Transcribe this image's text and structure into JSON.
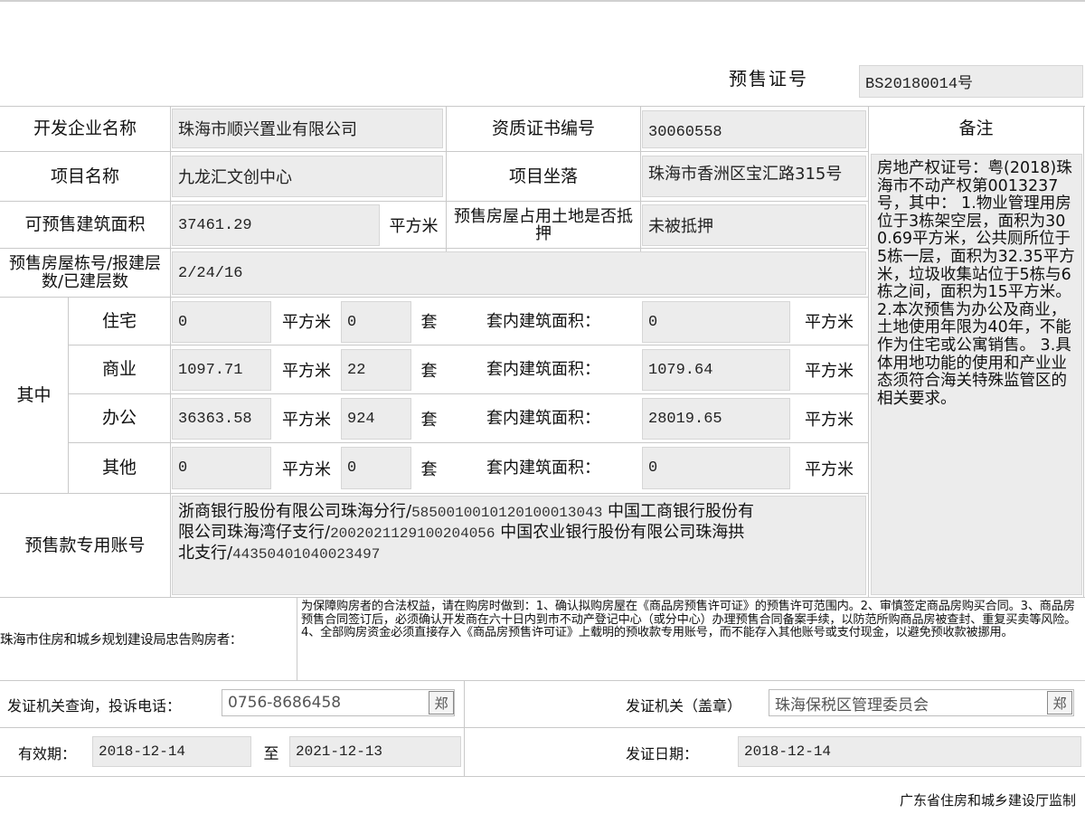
{
  "header": {
    "presale_label": "预售证号",
    "presale_no": "BS20180014号"
  },
  "rows": {
    "developer_label": "开发企业名称",
    "developer": "珠海市顺兴置业有限公司",
    "qual_label": "资质证书编号",
    "qual_no": "30060558",
    "remarks_label": "备注",
    "project_label": "项目名称",
    "project": "九龙汇文创中心",
    "location_label": "项目坐落",
    "location": "珠海市香洲区宝汇路315号",
    "area_label": "可预售建筑面积",
    "area": "37461.29",
    "sqm": "平方米",
    "mortgage_label": "预售房屋占用土地是否抵押",
    "mortgage": "未被抵押",
    "building_label": "预售房屋栋号/报建层数/已建层数",
    "building": "2/24/16"
  },
  "breakdown": {
    "of_which": "其中",
    "set_unit": "套",
    "inner_label": "套内建筑面积：",
    "items": [
      {
        "type": "住宅",
        "area": "0",
        "sets": "0",
        "inner": "0"
      },
      {
        "type": "商业",
        "area": "1097.71",
        "sets": "22",
        "inner": "1079.64"
      },
      {
        "type": "办公",
        "area": "36363.58",
        "sets": "924",
        "inner": "28019.65"
      },
      {
        "type": "其他",
        "area": "0",
        "sets": "0",
        "inner": "0"
      }
    ]
  },
  "notes": "房地产权证号：粤(2018)珠海市不动产权第0013237号，其中： 1.物业管理用房位于3栋架空层，面积为300.69平方米，公共厕所位于5栋一层，面积为32.35平方米，垃圾收集站位于5栋与6栋之间，面积为15平方米。 2.本次预售为办公及商业，土地使用年限为40年，不能作为住宅或公寓销售。 3.具体用地功能的使用和产业业态须符合海关特殊监管区的相关要求。",
  "account": {
    "label": "预售款专用账号",
    "line1_a": "浙商银行股份有限公司珠海分行/",
    "line1_num": "5850010010120100013043",
    "line1_b": " 中国工商银行股份有",
    "line2_a": "限公司珠海湾仔支行/",
    "line2_num": "2002021129100204056",
    "line2_b": " 中国农业银行股份有限公司珠海拱",
    "line3_a": "北支行/",
    "line3_num": "44350401040023497"
  },
  "advice": {
    "label": "珠海市住房和城乡规划建设局忠告购房者：",
    "text": "为保障购房者的合法权益，请在购房时做到：1、确认拟购房屋在《商品房预售许可证》的预售许可范围内。2、审慎签定商品房购买合同。3、商品房预售合同签订后，必须确认开发商在六十日内到市不动产登记中心（或分中心）办理预售合同备案手续，以防范所购商品房被查封、重复买卖等风险。4、全部购房资金必须直接存入《商品房预售许可证》上载明的预收款专用账号，而不能存入其他账号或支付现金，以避免预收款被挪用。"
  },
  "footer_rows": {
    "phone_label": "发证机关查询，投诉电话：",
    "phone": "0756-8686458",
    "issuer_label": "发证机关（盖章）",
    "issuer": "珠海保税区管理委员会",
    "seal_char": "郑",
    "valid_label": "有效期：",
    "valid_from": "2018-12-14",
    "to": "至",
    "valid_to": "2021-12-13",
    "issue_date_label": "发证日期：",
    "issue_date": "2018-12-14"
  },
  "supervisor": "广东省住房和城乡建设厅监制"
}
